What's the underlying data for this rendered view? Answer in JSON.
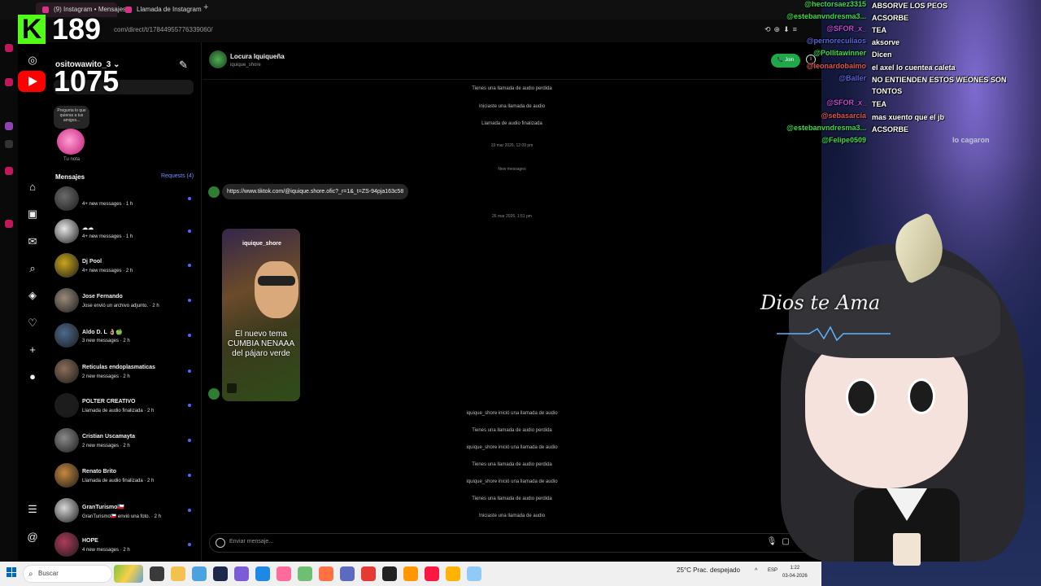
{
  "browser": {
    "tabs": [
      {
        "label": "(9) Instagram • Mensajes"
      },
      {
        "label": "Llamada de Instagram"
      }
    ],
    "new_tab": "+",
    "url": "com/direct/t/17844955776339060/"
  },
  "stream": {
    "kick_viewers": "189",
    "youtube_viewers": "1075"
  },
  "instagram": {
    "account": "ositowawito_3 ⌄",
    "note_prompt": "Pregunta lo que quieras a tus amigos...",
    "note_label": "Tu nota",
    "messages_title": "Mensajes",
    "requests": "Requests (4)",
    "conversations": [
      {
        "name": "",
        "subtitle": "4+ new messages · 1 h",
        "color": "#6b6b6b"
      },
      {
        "name": "☁☁",
        "subtitle": "4+ new messages · 1 h",
        "color": "#e8e8e8"
      },
      {
        "name": "Dj Pool",
        "subtitle": "4+ new messages · 2 h",
        "color": "#c9a61c"
      },
      {
        "name": "Jose Fernando",
        "subtitle": "Jose envió un archivo adjunto. · 2 h",
        "color": "#9a8b7a"
      },
      {
        "name": "Aldo D. L 👌🏼🍏",
        "subtitle": "3 new messages · 2 h",
        "color": "#4c6a8c"
      },
      {
        "name": "Reticulas endoplasmaticas",
        "subtitle": "2 new messages · 2 h",
        "color": "#8c6e5a"
      },
      {
        "name": "POLTER CREATIVO",
        "subtitle": "Llamada de audio finalizada · 2 h",
        "color": "#1d1d1d"
      },
      {
        "name": "Cristian Uscamayta",
        "subtitle": "2 new messages · 2 h",
        "color": "#8a8a8a"
      },
      {
        "name": "Renato Brito",
        "subtitle": "Llamada de audio finalizada · 2 h",
        "color": "#c7883d"
      },
      {
        "name": "GranTurismo🇨🇱",
        "subtitle": "GranTurismo🇨🇱 envió una foto. · 2 h",
        "color": "#d8d8d8"
      },
      {
        "name": "HOPE",
        "subtitle": "4 new messages · 2 h",
        "color": "#b03a5b"
      }
    ]
  },
  "chat": {
    "name": "Locura Iquiqueña",
    "handle": "iquique_shore",
    "join_label": "Join",
    "info_icon": "i",
    "system_top": [
      "Tienes una llamada de audio perdida",
      "Iniciaste una llamada de audio",
      "Llamada de audio finalizada"
    ],
    "timestamp_1": "19 mar 2026, 12:09 pm",
    "new_messages": "New messages",
    "link": "https://www.tiktok.com/@iquique.shore.ofic?_r=1&_t=ZS-94pja163c58",
    "timestamp_2": "26 mar 2026, 1:51 pm",
    "reel_user": "iquique_shore",
    "reel_caption": "El nuevo tema CUMBIA NENAAA del pájaro verde",
    "system_bottom": [
      "iquique_shore inició una llamada de audio",
      "Tienes una llamada de audio perdida",
      "iquique_shore inició una llamada de audio",
      "Tienes una llamada de audio perdida",
      "iquique_shore inició una llamada de audio",
      "Tienes una llamada de audio perdida",
      "Iniciaste una llamada de audio"
    ],
    "composer_placeholder": "Enviar mensaje..."
  },
  "stream_chat": [
    {
      "user": "@hectorsaez3315",
      "msg": "ABSORVE LOS PEOS",
      "color": "#3fd94d"
    },
    {
      "user": "@estebanvndresma3...",
      "msg": "ACSORBE",
      "color": "#3fd94d"
    },
    {
      "user": "@SFOR_x_",
      "msg": "TEA",
      "color": "#c04bd1"
    },
    {
      "user": "@pernoreculiaos",
      "msg": "aksorve",
      "color": "#5a63d8"
    },
    {
      "user": "@Pollitawinner",
      "msg": "Dicen",
      "color": "#3fd94d"
    },
    {
      "user": "@leonardobaimo",
      "msg": "el axel lo cuentea caleta",
      "color": "#e05252"
    },
    {
      "user": "@Baller",
      "msg": "NO ENTIENDEN ESTOS WEONES SON TONTOS",
      "color": "#5a63d8"
    },
    {
      "user": "@SFOR_x_",
      "msg": "TEA",
      "color": "#c04bd1"
    },
    {
      "user": "@sebasarcia",
      "msg": "mas xuento que el jb",
      "color": "#e05252"
    },
    {
      "user": "@estebanvndresma3...",
      "msg": "ACSORBE",
      "color": "#3fd94d"
    },
    {
      "user": "@Felipe0509",
      "msg": "",
      "color": "#3fd94d"
    }
  ],
  "stream_side": {
    "lo_cagaron": "lo cagaron",
    "dios_te_ama": "Dios te Ama"
  },
  "taskbar": {
    "search_placeholder": "Buscar",
    "weather": "25°C  Prac. despejado",
    "tray_arrow": "^",
    "language": "ESP",
    "time": "1:22",
    "date": "03-04-2026"
  },
  "colors": {
    "kick_green": "#53fc18",
    "youtube_red": "#ff0000",
    "ig_link_blue": "#7c8cff",
    "join_green": "#1fa84a"
  }
}
